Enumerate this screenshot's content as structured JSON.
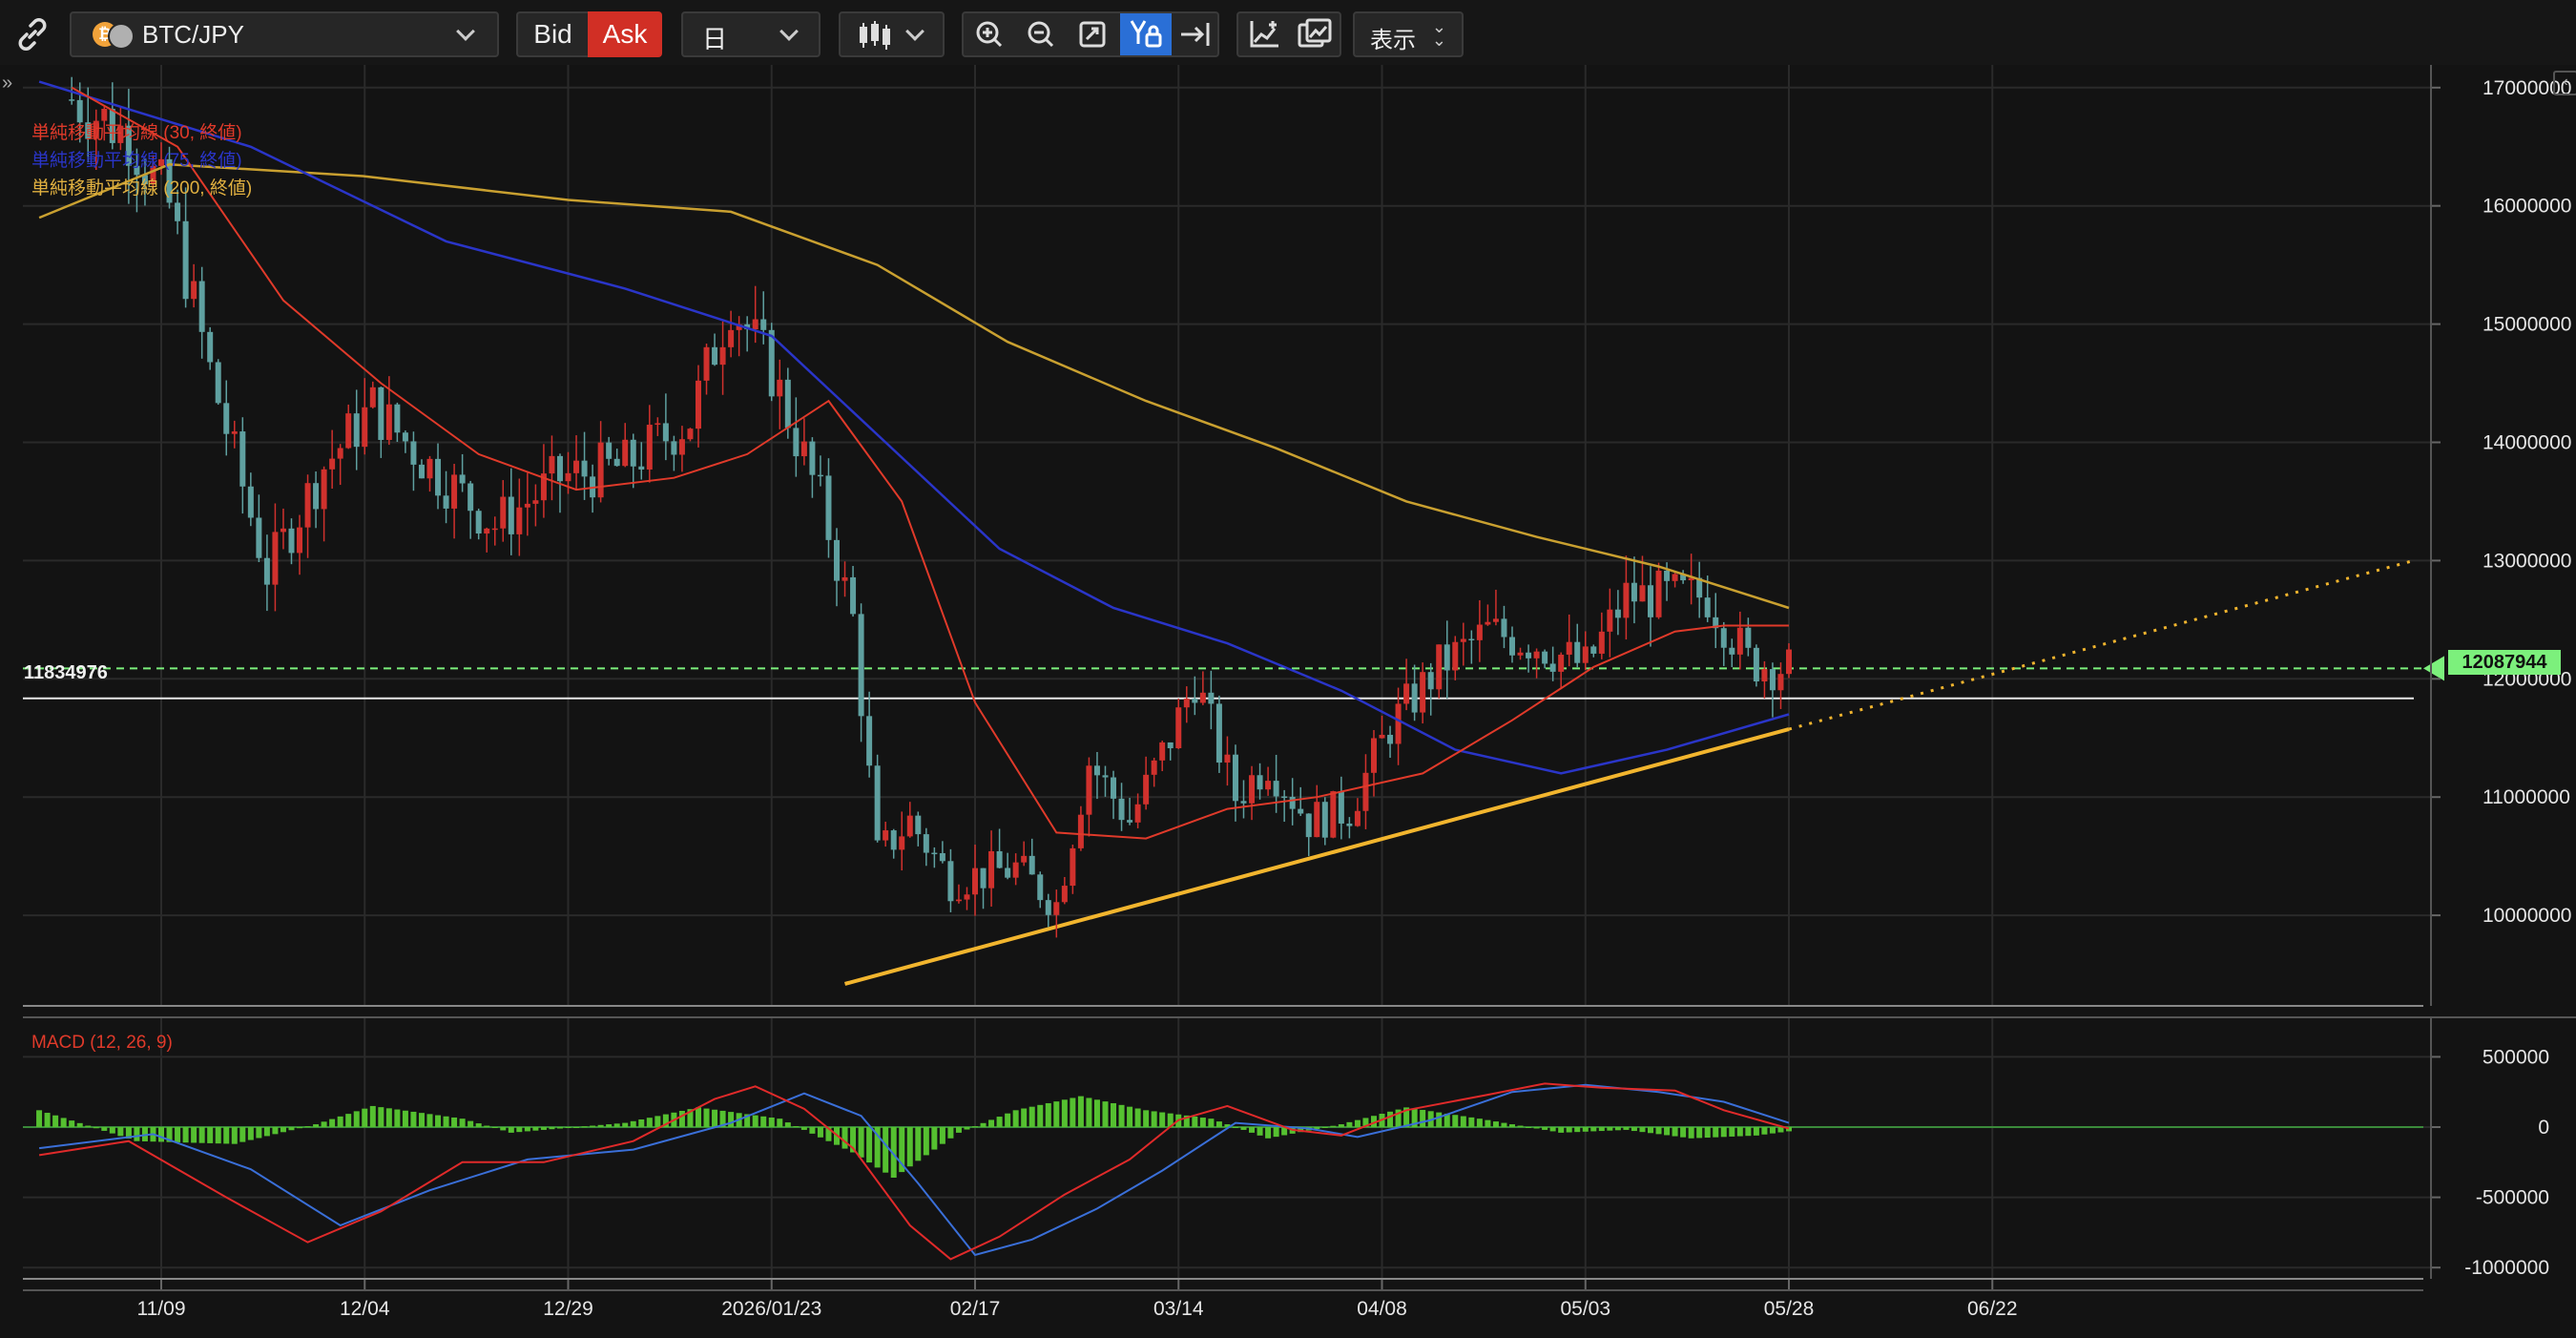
{
  "toolbar": {
    "symbol": "BTC/JPY",
    "bid_label": "Bid",
    "ask_label": "Ask",
    "timeframe": "日",
    "display_label": "表示"
  },
  "legends": {
    "sma30": "単純移動平均線 (30, 終値)",
    "sma75": "単純移動平均線 (75, 終値)",
    "sma200": "単純移動平均線 (200, 終値)",
    "macd": "MACD (12, 26, 9)"
  },
  "colors": {
    "up": "#d0312d",
    "down": "#5fa0a0",
    "sma30": "#e03a2a",
    "sma75": "#2a35c8",
    "sma200": "#c9a030",
    "trendline": "#f2b52e",
    "current_price": "#7cf07c",
    "macd_hist": "#55c030"
  },
  "chart_data": [
    {
      "type": "candlestick",
      "symbol": "BTC/JPY",
      "ylim": [
        9300000,
        17100000
      ],
      "y_ticks": [
        "17000000",
        "16000000",
        "15000000",
        "14000000",
        "13000000",
        "12000000",
        "11000000",
        "10000000"
      ],
      "x_tick_labels": [
        "11/09",
        "12/04",
        "12/29",
        "2026/01/23",
        "02/17",
        "03/14",
        "04/08",
        "05/03",
        "05/28",
        "06/22"
      ],
      "horizontal_line": {
        "label": "11834976",
        "value": 11834976
      },
      "current_price": {
        "label": "12087944",
        "value": 12087944
      },
      "trendline_from": {
        "date": "2026-02-01",
        "value": 9420000
      },
      "trendline_to": {
        "date": "2026-06-28",
        "value": 12150000
      },
      "key_closes": [
        {
          "date": "2025-10-29",
          "value": 16900000
        },
        {
          "date": "2025-11-05",
          "value": 16600000
        },
        {
          "date": "2025-11-10",
          "value": 16000000
        },
        {
          "date": "2025-11-15",
          "value": 14600000
        },
        {
          "date": "2025-11-22",
          "value": 12900000
        },
        {
          "date": "2025-11-29",
          "value": 13800000
        },
        {
          "date": "2025-12-05",
          "value": 14300000
        },
        {
          "date": "2025-12-12",
          "value": 13800000
        },
        {
          "date": "2025-12-20",
          "value": 13300000
        },
        {
          "date": "2025-12-28",
          "value": 13700000
        },
        {
          "date": "2026-01-05",
          "value": 13800000
        },
        {
          "date": "2026-01-13",
          "value": 14200000
        },
        {
          "date": "2026-01-18",
          "value": 15200000
        },
        {
          "date": "2026-01-23",
          "value": 14600000
        },
        {
          "date": "2026-01-29",
          "value": 13500000
        },
        {
          "date": "2026-02-02",
          "value": 12500000
        },
        {
          "date": "2026-02-05",
          "value": 10500000
        },
        {
          "date": "2026-02-09",
          "value": 10800000
        },
        {
          "date": "2026-02-14",
          "value": 10300000
        },
        {
          "date": "2026-02-22",
          "value": 10400000
        },
        {
          "date": "2026-02-27",
          "value": 10100000
        },
        {
          "date": "2026-03-03",
          "value": 11300000
        },
        {
          "date": "2026-03-08",
          "value": 10800000
        },
        {
          "date": "2026-03-13",
          "value": 11500000
        },
        {
          "date": "2026-03-16",
          "value": 12000000
        },
        {
          "date": "2026-03-21",
          "value": 11000000
        },
        {
          "date": "2026-03-25",
          "value": 11300000
        },
        {
          "date": "2026-03-30",
          "value": 10800000
        },
        {
          "date": "2026-04-04",
          "value": 10900000
        },
        {
          "date": "2026-04-09",
          "value": 11600000
        },
        {
          "date": "2026-04-15",
          "value": 12100000
        },
        {
          "date": "2026-04-21",
          "value": 12400000
        },
        {
          "date": "2026-04-27",
          "value": 12300000
        },
        {
          "date": "2026-05-03",
          "value": 12100000
        },
        {
          "date": "2026-05-08",
          "value": 12700000
        },
        {
          "date": "2026-05-15",
          "value": 12700000
        },
        {
          "date": "2026-05-18",
          "value": 12700000
        },
        {
          "date": "2026-05-23",
          "value": 12150000
        },
        {
          "date": "2026-05-28",
          "value": 12090000
        }
      ],
      "sma30": [
        {
          "date": "2025-10-29",
          "value": 17000000
        },
        {
          "date": "2025-11-11",
          "value": 16500000
        },
        {
          "date": "2025-11-24",
          "value": 15200000
        },
        {
          "date": "2025-12-06",
          "value": 14500000
        },
        {
          "date": "2025-12-18",
          "value": 13900000
        },
        {
          "date": "2025-12-30",
          "value": 13600000
        },
        {
          "date": "2026-01-11",
          "value": 13700000
        },
        {
          "date": "2026-01-20",
          "value": 13900000
        },
        {
          "date": "2026-01-30",
          "value": 14350000
        },
        {
          "date": "2026-02-08",
          "value": 13500000
        },
        {
          "date": "2026-02-17",
          "value": 11800000
        },
        {
          "date": "2026-02-27",
          "value": 10700000
        },
        {
          "date": "2026-03-10",
          "value": 10650000
        },
        {
          "date": "2026-03-20",
          "value": 10900000
        },
        {
          "date": "2026-03-31",
          "value": 11000000
        },
        {
          "date": "2026-04-13",
          "value": 11200000
        },
        {
          "date": "2026-04-24",
          "value": 11650000
        },
        {
          "date": "2026-05-04",
          "value": 12100000
        },
        {
          "date": "2026-05-14",
          "value": 12400000
        },
        {
          "date": "2026-05-20",
          "value": 12450000
        },
        {
          "date": "2026-05-28",
          "value": 12450000
        }
      ],
      "sma75": [
        {
          "date": "2025-10-25",
          "value": 17050000
        },
        {
          "date": "2025-11-20",
          "value": 16500000
        },
        {
          "date": "2025-12-14",
          "value": 15700000
        },
        {
          "date": "2026-01-05",
          "value": 15300000
        },
        {
          "date": "2026-01-23",
          "value": 14900000
        },
        {
          "date": "2026-02-06",
          "value": 14000000
        },
        {
          "date": "2026-02-20",
          "value": 13100000
        },
        {
          "date": "2026-03-06",
          "value": 12600000
        },
        {
          "date": "2026-03-20",
          "value": 12300000
        },
        {
          "date": "2026-04-03",
          "value": 11900000
        },
        {
          "date": "2026-04-17",
          "value": 11400000
        },
        {
          "date": "2026-04-30",
          "value": 11200000
        },
        {
          "date": "2026-05-13",
          "value": 11400000
        },
        {
          "date": "2026-05-28",
          "value": 11700000
        }
      ],
      "sma200": [
        {
          "date": "2025-10-25",
          "value": 15900000
        },
        {
          "date": "2025-11-10",
          "value": 16350000
        },
        {
          "date": "2025-12-04",
          "value": 16250000
        },
        {
          "date": "2025-12-29",
          "value": 16050000
        },
        {
          "date": "2026-01-18",
          "value": 15950000
        },
        {
          "date": "2026-02-05",
          "value": 15500000
        },
        {
          "date": "2026-02-21",
          "value": 14850000
        },
        {
          "date": "2026-03-10",
          "value": 14350000
        },
        {
          "date": "2026-03-26",
          "value": 13950000
        },
        {
          "date": "2026-04-11",
          "value": 13500000
        },
        {
          "date": "2026-04-27",
          "value": 13200000
        },
        {
          "date": "2026-05-12",
          "value": 12950000
        },
        {
          "date": "2026-05-28",
          "value": 12600000
        }
      ]
    },
    {
      "type": "macd",
      "ylim": [
        -1100000,
        650000
      ],
      "y_ticks": [
        "500000",
        "0",
        "-500000",
        "-1000000"
      ],
      "macd_line": [
        {
          "date": "2025-10-25",
          "value": -200000
        },
        {
          "date": "2025-11-05",
          "value": -100000
        },
        {
          "date": "2025-11-17",
          "value": -500000
        },
        {
          "date": "2025-11-27",
          "value": -820000
        },
        {
          "date": "2025-12-06",
          "value": -600000
        },
        {
          "date": "2025-12-16",
          "value": -250000
        },
        {
          "date": "2025-12-26",
          "value": -250000
        },
        {
          "date": "2026-01-06",
          "value": -100000
        },
        {
          "date": "2026-01-16",
          "value": 200000
        },
        {
          "date": "2026-01-21",
          "value": 290000
        },
        {
          "date": "2026-01-27",
          "value": 130000
        },
        {
          "date": "2026-02-02",
          "value": -150000
        },
        {
          "date": "2026-02-09",
          "value": -700000
        },
        {
          "date": "2026-02-14",
          "value": -940000
        },
        {
          "date": "2026-02-20",
          "value": -780000
        },
        {
          "date": "2026-02-28",
          "value": -480000
        },
        {
          "date": "2026-03-08",
          "value": -230000
        },
        {
          "date": "2026-03-14",
          "value": 50000
        },
        {
          "date": "2026-03-20",
          "value": 150000
        },
        {
          "date": "2026-03-28",
          "value": -20000
        },
        {
          "date": "2026-04-03",
          "value": -60000
        },
        {
          "date": "2026-04-11",
          "value": 120000
        },
        {
          "date": "2026-04-21",
          "value": 230000
        },
        {
          "date": "2026-04-28",
          "value": 310000
        },
        {
          "date": "2026-05-05",
          "value": 280000
        },
        {
          "date": "2026-05-14",
          "value": 260000
        },
        {
          "date": "2026-05-20",
          "value": 120000
        },
        {
          "date": "2026-05-28",
          "value": -10000
        }
      ],
      "signal_line": [
        {
          "date": "2025-10-25",
          "value": -150000
        },
        {
          "date": "2025-11-08",
          "value": -50000
        },
        {
          "date": "2025-11-20",
          "value": -300000
        },
        {
          "date": "2025-12-01",
          "value": -700000
        },
        {
          "date": "2025-12-12",
          "value": -450000
        },
        {
          "date": "2025-12-24",
          "value": -230000
        },
        {
          "date": "2026-01-06",
          "value": -160000
        },
        {
          "date": "2026-01-18",
          "value": 30000
        },
        {
          "date": "2026-01-27",
          "value": 240000
        },
        {
          "date": "2026-02-03",
          "value": 80000
        },
        {
          "date": "2026-02-10",
          "value": -400000
        },
        {
          "date": "2026-02-17",
          "value": -910000
        },
        {
          "date": "2026-02-24",
          "value": -800000
        },
        {
          "date": "2026-03-04",
          "value": -580000
        },
        {
          "date": "2026-03-12",
          "value": -310000
        },
        {
          "date": "2026-03-21",
          "value": 30000
        },
        {
          "date": "2026-03-30",
          "value": -10000
        },
        {
          "date": "2026-04-05",
          "value": -70000
        },
        {
          "date": "2026-04-14",
          "value": 50000
        },
        {
          "date": "2026-04-24",
          "value": 250000
        },
        {
          "date": "2026-05-03",
          "value": 300000
        },
        {
          "date": "2026-05-12",
          "value": 250000
        },
        {
          "date": "2026-05-20",
          "value": 180000
        },
        {
          "date": "2026-05-28",
          "value": 30000
        }
      ],
      "histogram": [
        {
          "date": "2025-10-25",
          "value": 120000
        },
        {
          "date": "2025-11-06",
          "value": -100000
        },
        {
          "date": "2025-11-18",
          "value": -120000
        },
        {
          "date": "2025-11-28",
          "value": 20000
        },
        {
          "date": "2025-12-05",
          "value": 150000
        },
        {
          "date": "2025-12-16",
          "value": 60000
        },
        {
          "date": "2025-12-22",
          "value": -40000
        },
        {
          "date": "2026-01-05",
          "value": 30000
        },
        {
          "date": "2026-01-14",
          "value": 140000
        },
        {
          "date": "2026-01-24",
          "value": 60000
        },
        {
          "date": "2026-02-02",
          "value": -180000
        },
        {
          "date": "2026-02-07",
          "value": -360000
        },
        {
          "date": "2026-02-15",
          "value": -40000
        },
        {
          "date": "2026-02-22",
          "value": 120000
        },
        {
          "date": "2026-03-02",
          "value": 220000
        },
        {
          "date": "2026-03-10",
          "value": 120000
        },
        {
          "date": "2026-03-18",
          "value": 60000
        },
        {
          "date": "2026-03-25",
          "value": -80000
        },
        {
          "date": "2026-04-03",
          "value": 20000
        },
        {
          "date": "2026-04-11",
          "value": 140000
        },
        {
          "date": "2026-04-20",
          "value": 60000
        },
        {
          "date": "2026-04-30",
          "value": -40000
        },
        {
          "date": "2026-05-08",
          "value": -20000
        },
        {
          "date": "2026-05-16",
          "value": -80000
        },
        {
          "date": "2026-05-24",
          "value": -60000
        },
        {
          "date": "2026-05-28",
          "value": -30000
        }
      ]
    }
  ]
}
